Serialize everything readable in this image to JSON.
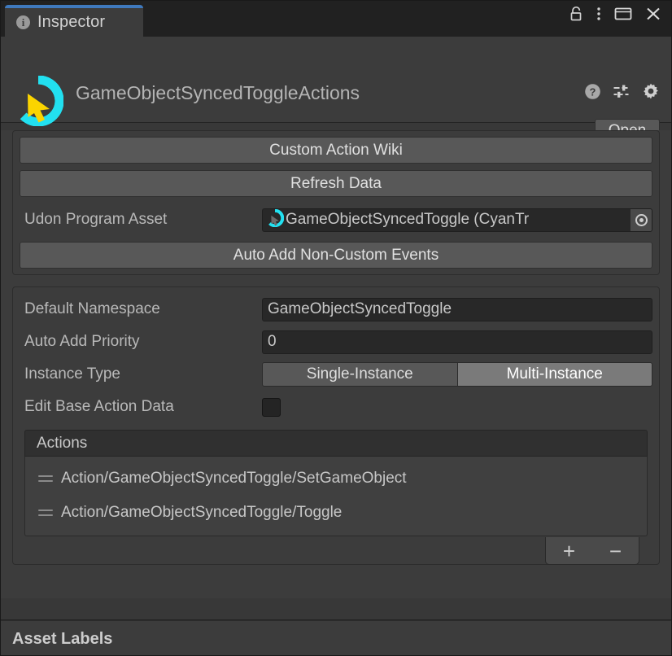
{
  "window": {
    "tab_label": "Inspector",
    "tab_icon": "info-icon",
    "controls": [
      {
        "name": "lock-icon",
        "label": "Lock"
      },
      {
        "name": "kebab-menu-icon",
        "label": "More"
      },
      {
        "name": "maximize-icon",
        "label": "Maximize"
      },
      {
        "name": "close-icon",
        "label": "Close"
      }
    ]
  },
  "header": {
    "asset_icon": "cyan-trigger-action-icon",
    "title": "GameObjectSyncedToggleActions",
    "icons": [
      {
        "name": "help-icon",
        "label": "Help"
      },
      {
        "name": "preset-icon",
        "label": "Presets"
      },
      {
        "name": "gear-icon",
        "label": "Settings"
      }
    ],
    "open_button": "Open"
  },
  "section_top": {
    "wiki_button": "Custom Action Wiki",
    "refresh_button": "Refresh Data",
    "udon_program_asset": {
      "label": "Udon Program Asset",
      "value": "GameObjectSyncedToggle (CyanTr",
      "icon": "cyan-trigger-asset-icon",
      "picker_icon": "object-picker-icon"
    },
    "auto_add_button": "Auto Add Non-Custom Events"
  },
  "section_main": {
    "default_namespace": {
      "label": "Default Namespace",
      "value": "GameObjectSyncedToggle",
      "placeholder": ""
    },
    "auto_add_priority": {
      "label": "Auto Add Priority",
      "value": "0",
      "placeholder": ""
    },
    "instance_type": {
      "label": "Instance Type",
      "options": [
        "Single-Instance",
        "Multi-Instance"
      ],
      "selected": "Multi-Instance"
    },
    "edit_base_action_data": {
      "label": "Edit Base Action Data",
      "checked": false
    },
    "actions_list": {
      "header": "Actions",
      "items": [
        "Action/GameObjectSyncedToggle/SetGameObject",
        "Action/GameObjectSyncedToggle/Toggle"
      ],
      "add_button": "+",
      "remove_button": "−"
    }
  },
  "footer": {
    "asset_labels": "Asset Labels"
  },
  "colors": {
    "accent_blue": "#3f79bd",
    "window_bg": "#383838",
    "panel_bg": "#3c3c3c",
    "titlebar_bg": "#212121",
    "button_face": "#585858",
    "button_selected": "#7a7a7a",
    "field_bg": "#282828",
    "list_bg": "#404040",
    "icon_cyan": "#22e0f0",
    "icon_yellow": "#fbd400"
  }
}
